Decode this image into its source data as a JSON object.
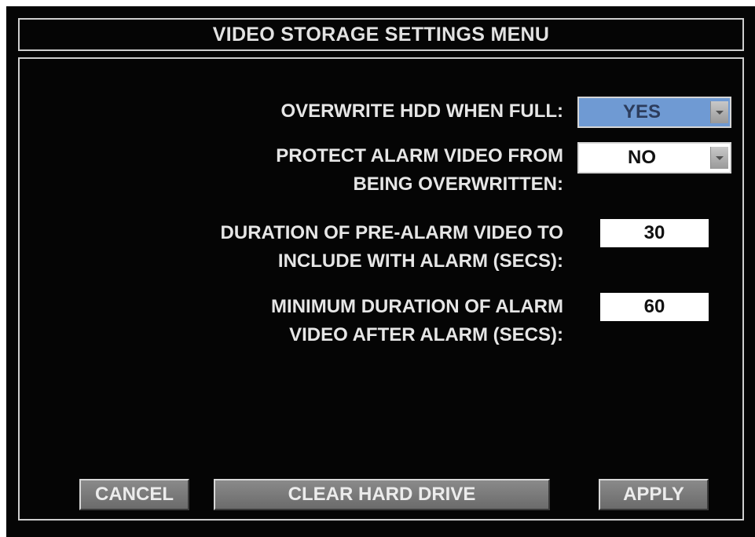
{
  "menu": {
    "title": "VIDEO STORAGE SETTINGS MENU"
  },
  "settings": {
    "overwrite": {
      "label": "OVERWRITE HDD WHEN FULL:",
      "value": "YES"
    },
    "protect": {
      "label_line1": "PROTECT ALARM VIDEO FROM",
      "label_line2": "BEING OVERWRITTEN:",
      "value": "NO"
    },
    "pre_alarm": {
      "label_line1": "DURATION OF PRE-ALARM VIDEO TO",
      "label_line2": "INCLUDE WITH ALARM (SECS):",
      "value": "30"
    },
    "min_duration": {
      "label_line1": "MINIMUM DURATION OF ALARM",
      "label_line2": "VIDEO AFTER ALARM (SECS):",
      "value": "60"
    }
  },
  "buttons": {
    "cancel": "CANCEL",
    "clear": "CLEAR HARD DRIVE",
    "apply": "APPLY"
  },
  "colors": {
    "background": "#050505",
    "text": "#e6e6e6",
    "selected_dropdown": "#6f9ad3",
    "button": "#7a7a7a"
  },
  "icons": {
    "dropdown_arrow": "chevron-down-icon"
  }
}
